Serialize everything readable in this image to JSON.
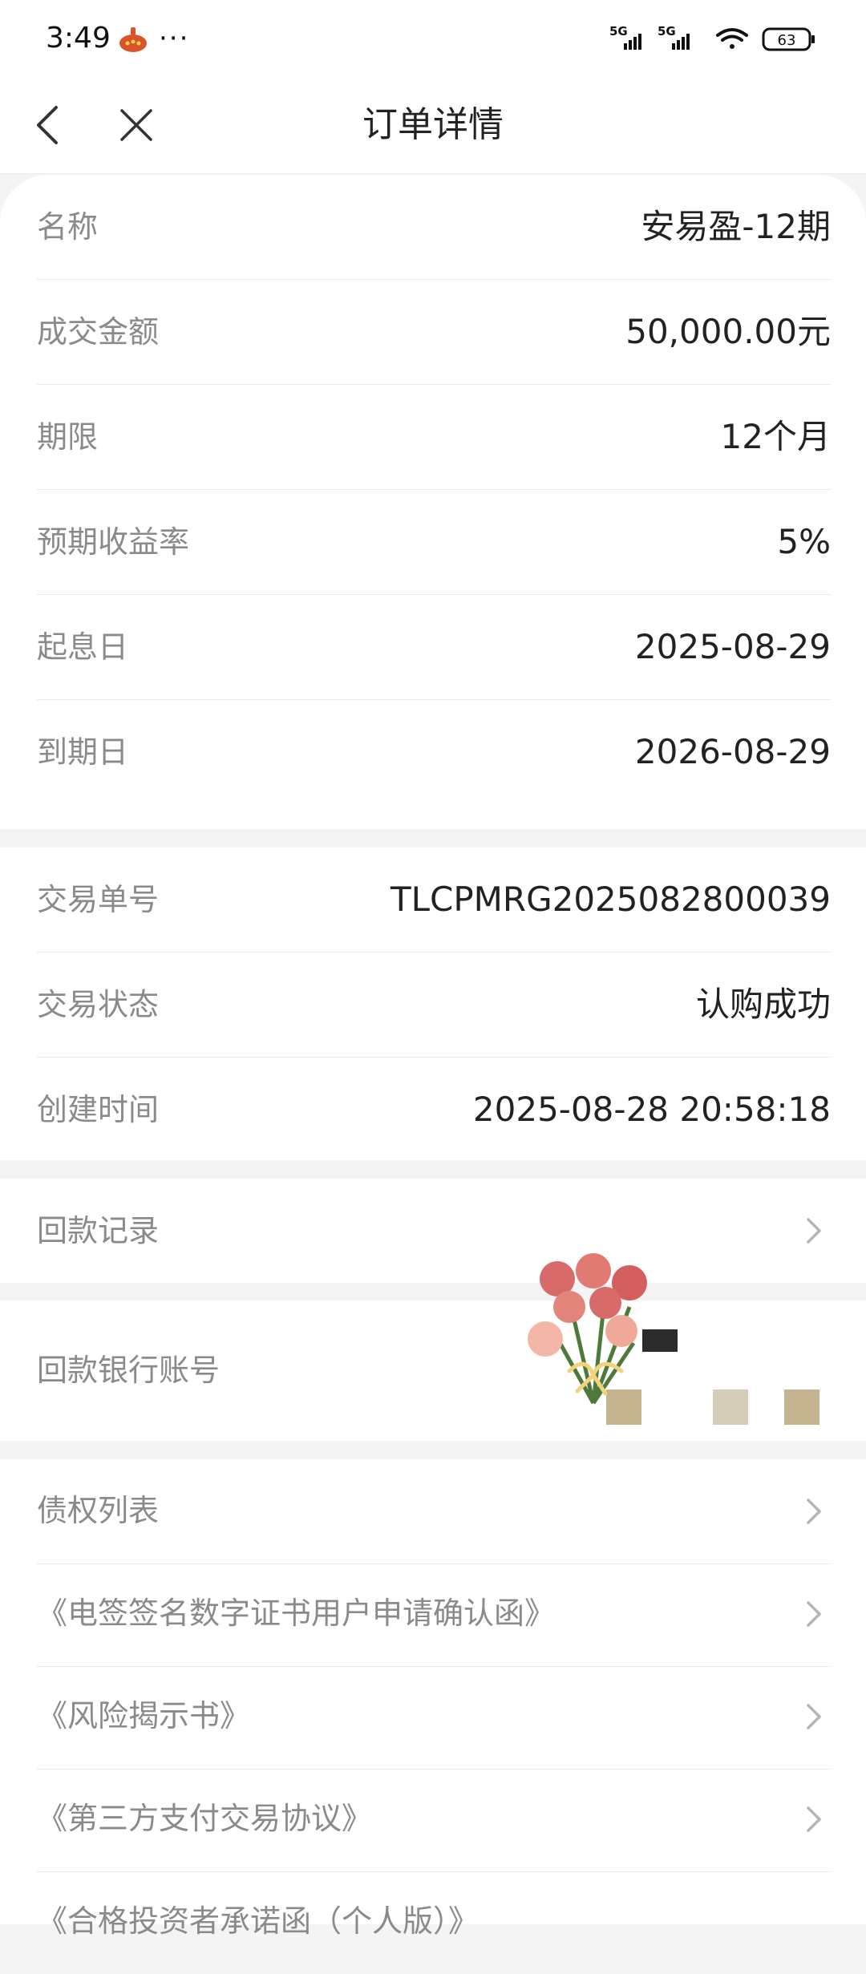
{
  "status_bar": {
    "time": "3:49",
    "dots": "···",
    "signal_1": "5G",
    "signal_2": "5G",
    "battery": "63"
  },
  "nav": {
    "title": "订单详情"
  },
  "order_info": [
    {
      "label": "名称",
      "value": "安易盈-12期"
    },
    {
      "label": "成交金额",
      "value": "50,000.00元"
    },
    {
      "label": "期限",
      "value": "12个月"
    },
    {
      "label": "预期收益率",
      "value": "5%"
    },
    {
      "label": "起息日",
      "value": "2025-08-29"
    },
    {
      "label": "到期日",
      "value": "2026-08-29"
    }
  ],
  "transaction_info": [
    {
      "label": "交易单号",
      "value": "TLCPMRG2025082800039"
    },
    {
      "label": "交易状态",
      "value": "认购成功"
    },
    {
      "label": "创建时间",
      "value": "2025-08-28 20:58:18"
    }
  ],
  "repayment_record": {
    "label": "回款记录"
  },
  "repayment_account": {
    "label": "回款银行账号"
  },
  "documents": [
    {
      "label": "债权列表"
    },
    {
      "label": "《电签签名数字证书用户申请确认函》"
    },
    {
      "label": "《风险揭示书》"
    },
    {
      "label": "《第三方支付交易协议》"
    },
    {
      "label": "《合格投资者承诺函（个人版）》"
    }
  ]
}
